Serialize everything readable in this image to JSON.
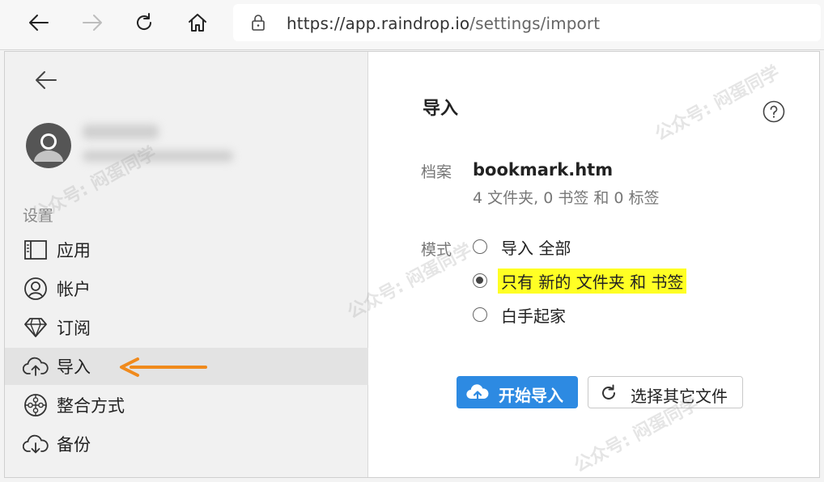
{
  "browser": {
    "url_main": "https://app.raindrop.io",
    "url_path": "/settings/import"
  },
  "sidebar": {
    "section_label": "设置",
    "items": [
      {
        "label": "应用",
        "icon": "layout-icon"
      },
      {
        "label": "帐户",
        "icon": "user-circle-icon"
      },
      {
        "label": "订阅",
        "icon": "diamond-icon"
      },
      {
        "label": "导入",
        "icon": "cloud-upload-icon",
        "active": true
      },
      {
        "label": "整合方式",
        "icon": "puzzle-icon"
      },
      {
        "label": "备份",
        "icon": "cloud-download-icon"
      }
    ]
  },
  "main": {
    "title": "导入",
    "file_label": "档案",
    "file_name": "bookmark.htm",
    "file_stats": "4 文件夹, 0 书签 和 0 标签",
    "mode_label": "模式",
    "modes": [
      {
        "label": "导入 全部",
        "checked": false
      },
      {
        "label": "只有 新的 文件夹 和 书签",
        "checked": true
      },
      {
        "label": "白手起家",
        "checked": false
      }
    ],
    "start_button": "开始导入",
    "choose_button": "选择其它文件"
  },
  "watermark": "公众号: 闷蛋同学",
  "colors": {
    "primary": "#2d8ae2",
    "highlight": "#ffff24",
    "callout": "#f08a1c"
  }
}
